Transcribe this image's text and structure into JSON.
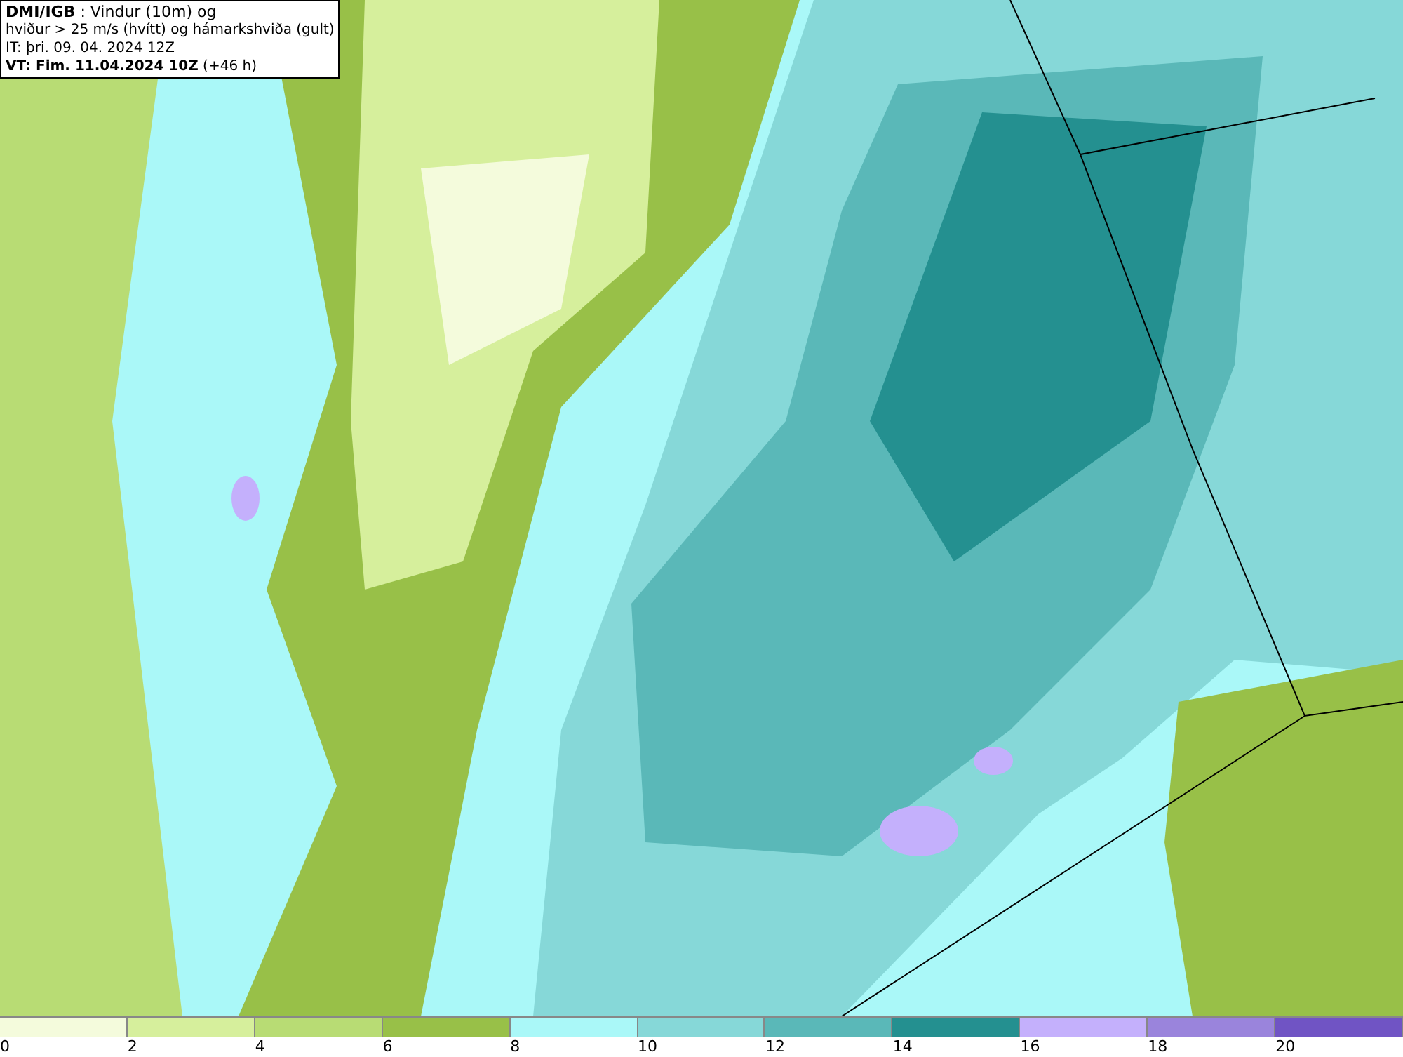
{
  "title_box": {
    "lines": [
      "**DMI/IGB** : Vindur (10m) og",
      "hviður > 25 m/s (hvítt) og hámarkshviða (gult)",
      "IT: þri. 09. 04. 2024 12Z",
      "**VT: Fim. 11.04.2024 10Z** (+46 h)"
    ]
  },
  "legend": {
    "bins": [
      {
        "color": "#f4fbdc",
        "label": "0"
      },
      {
        "color": "#d6ef9c",
        "label": "2"
      },
      {
        "color": "#b8dc74",
        "label": "4"
      },
      {
        "color": "#98c048",
        "label": "6"
      },
      {
        "color": "#aaf8f8",
        "label": "8"
      },
      {
        "color": "#86d8d8",
        "label": "10"
      },
      {
        "color": "#5ab8b8",
        "label": "12"
      },
      {
        "color": "#249090",
        "label": "14"
      },
      {
        "color": "#c4b0fc",
        "label": "16"
      },
      {
        "color": "#9a84dc",
        "label": "18"
      },
      {
        "color": "#7054c4",
        "label": "20"
      }
    ]
  }
}
